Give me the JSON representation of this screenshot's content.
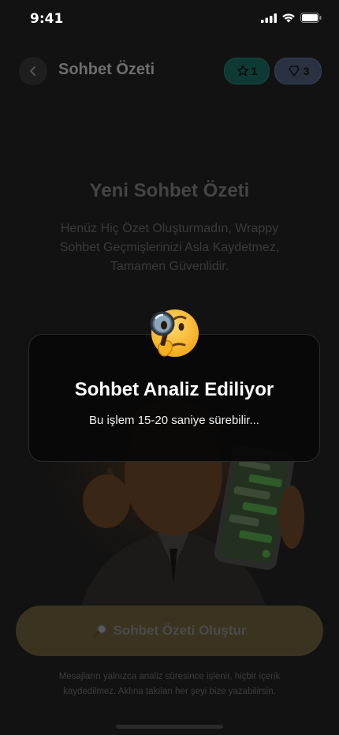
{
  "status_bar": {
    "time": "9:41"
  },
  "header": {
    "title": "Sohbet Özeti",
    "star_count": "1",
    "gem_count": "3"
  },
  "empty_state": {
    "title": "Yeni Sohbet Özeti",
    "description": "Henüz Hiç Özet Oluşturmadın, Wrappy Sohbet Geçmişlerinizi Asla Kaydetmez, Tamamen Güvenlidir."
  },
  "cta": {
    "label": "Sohbet Özeti Oluştur",
    "icon": "magnifier-icon"
  },
  "footnote": "Mesajların yalnızca analiz süresince işlenir, hiçbir içerik kaydedilmez. Aklına takılan her şeyi bize yazabilirsin.",
  "loading_modal": {
    "title": "Sohbet Analiz Ediliyor",
    "subtitle": "Bu işlem 15-20 saniye sürebilir...",
    "emoji": "thinking-face-with-magnifier"
  },
  "colors": {
    "accent_cta": "#3a3320",
    "star_pill": "#0f3a33",
    "gem_pill": "#2a3242"
  }
}
